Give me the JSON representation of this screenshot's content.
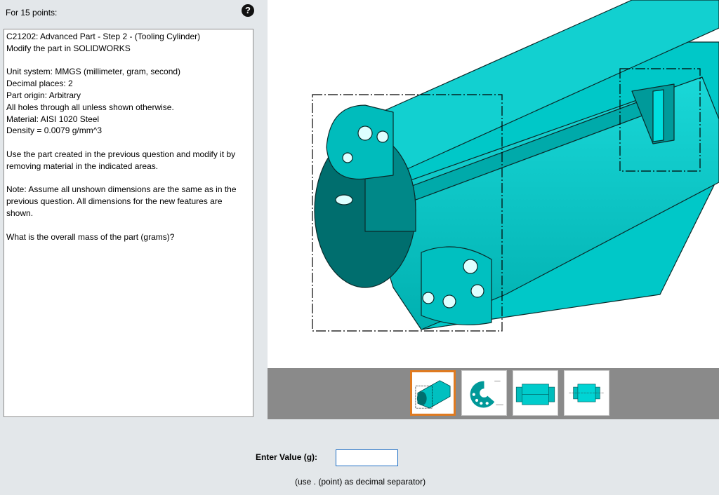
{
  "header": {
    "points_label": "For 15 points:",
    "help_icon": "question-circle-icon"
  },
  "question": {
    "paragraphs": [
      [
        "C21202:  Advanced Part - Step 2 - (Tooling Cylinder)",
        "Modify the part in SOLIDWORKS"
      ],
      [
        "Unit system: MMGS (millimeter, gram, second)",
        "Decimal places: 2",
        "Part origin: Arbitrary",
        "All holes through all unless shown otherwise.",
        "Material: AISI 1020 Steel",
        "Density = 0.0079 g/mm^3"
      ],
      [
        "Use the part created in the previous question and modify it by removing material in the indicated areas."
      ],
      [
        "Note: Assume all unshown dimensions are the same as in the previous question.  All dimensions for the new features are shown."
      ],
      [
        "What is the overall mass of the part (grams)?"
      ]
    ]
  },
  "viewer": {
    "image": "tooling-cylinder-isometric",
    "colors": {
      "part_face": "#00cccc",
      "part_light": "#1ee2e2",
      "part_dark": "#009f9f",
      "part_darker": "#006f6f"
    }
  },
  "thumbnails": [
    {
      "name": "isometric-view",
      "selected": true
    },
    {
      "name": "end-view-drawing",
      "selected": false
    },
    {
      "name": "side-view",
      "selected": false
    },
    {
      "name": "side-view-small",
      "selected": false
    }
  ],
  "answer": {
    "label": "Enter Value (g):",
    "value": "",
    "placeholder": ""
  },
  "hint": "(use . (point) as decimal separator)"
}
